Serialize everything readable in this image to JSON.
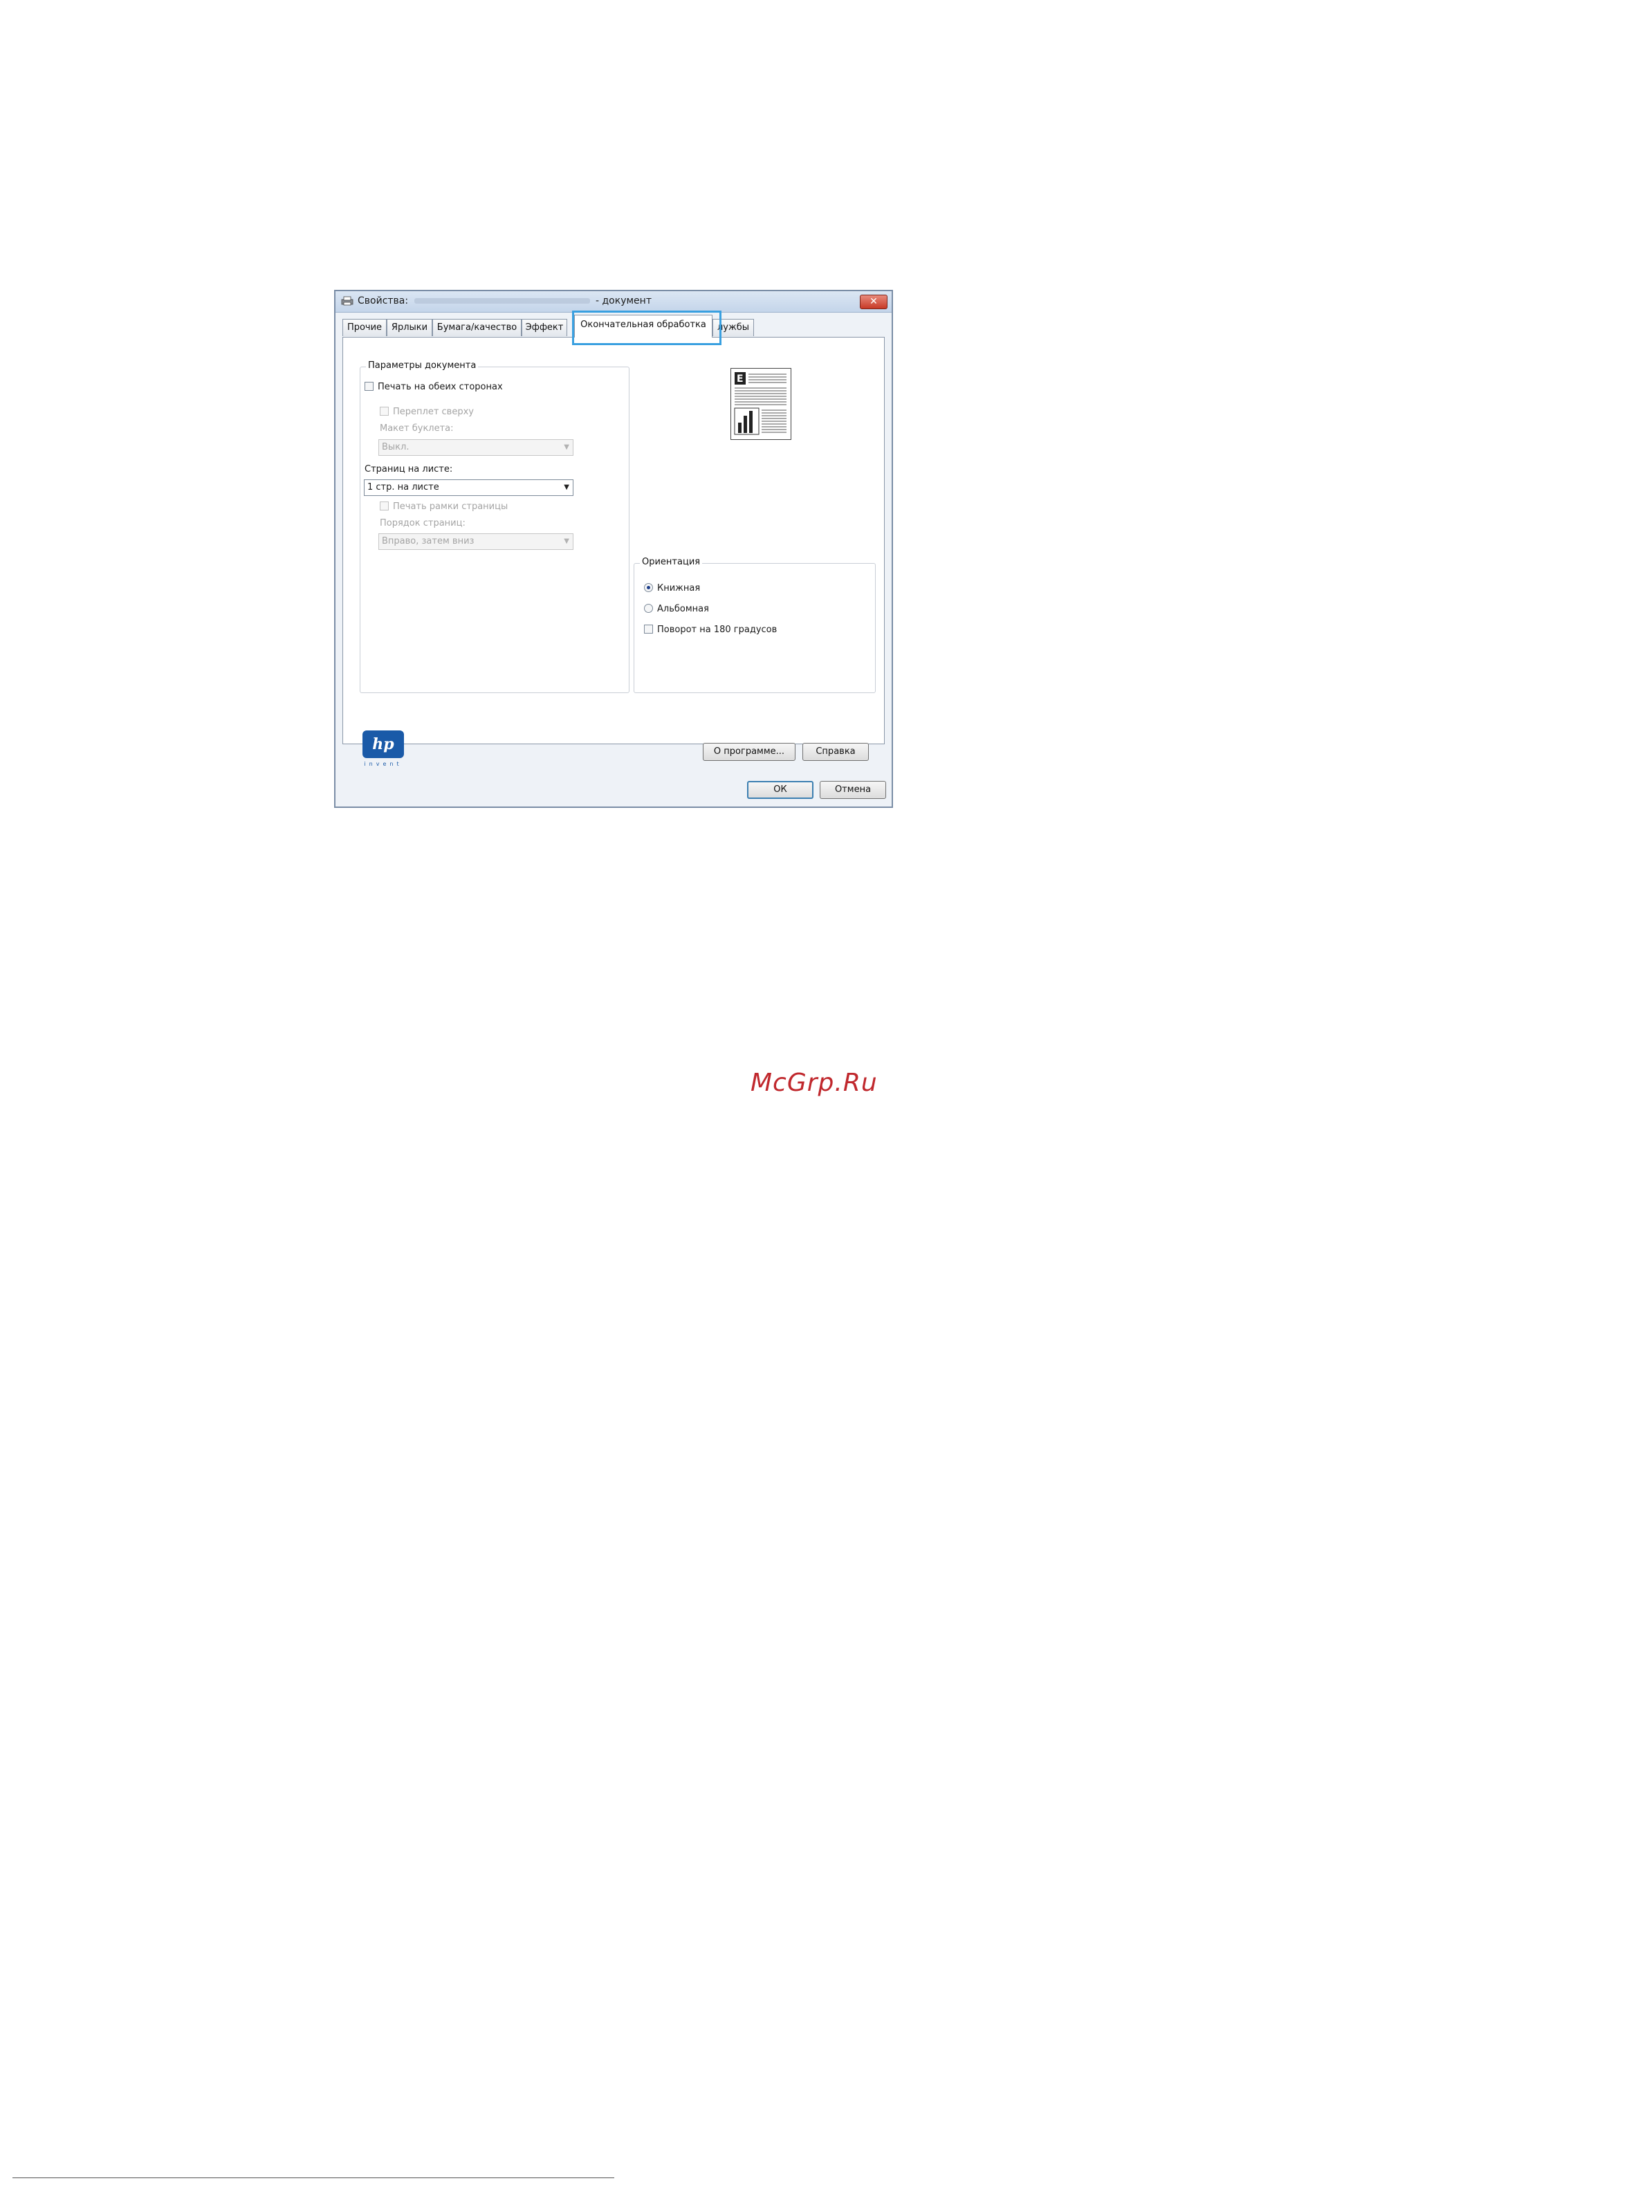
{
  "window": {
    "title_prefix": "Свойства:",
    "title_suffix": "- документ",
    "close_label": "✕"
  },
  "tabs": [
    {
      "label": "Прочие"
    },
    {
      "label": "Ярлыки"
    },
    {
      "label": "Бумага/качество"
    },
    {
      "label": "Эффект"
    },
    {
      "label": "Окончательная обработка",
      "active": true
    },
    {
      "label": "лужбы"
    }
  ],
  "document_options": {
    "group_title": "Параметры документа",
    "print_both_sides": "Печать на обеих сторонах",
    "flip_pages_up": "Переплет сверху",
    "booklet_layout_label": "Макет буклета:",
    "booklet_layout_value": "Выкл.",
    "pages_per_sheet_label": "Страниц на листе:",
    "pages_per_sheet_value": "1 стр. на листе",
    "print_page_borders": "Печать рамки страницы",
    "page_order_label": "Порядок страниц:",
    "page_order_value": "Вправо, затем вниз"
  },
  "orientation": {
    "group_title": "Ориентация",
    "portrait": "Книжная",
    "landscape": "Альбомная",
    "rotate_180": "Поворот на 180 градусов",
    "selected": "portrait"
  },
  "buttons": {
    "about": "О программе...",
    "help": "Справка",
    "ok": "ОК",
    "cancel": "Отмена"
  },
  "logo": {
    "mark": "hp",
    "tagline": "invent"
  },
  "watermark": "McGrp.Ru",
  "colors": {
    "highlight": "#3aa0e0",
    "watermark": "#c0282d",
    "hp_blue": "#1a5aa8"
  }
}
